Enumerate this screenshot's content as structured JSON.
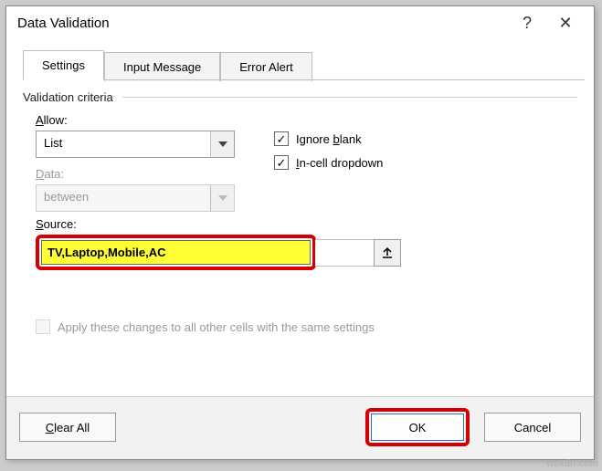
{
  "dialog": {
    "title": "Data Validation",
    "help_icon": "?",
    "close_icon": "✕"
  },
  "tabs": {
    "settings": "Settings",
    "input_message": "Input Message",
    "error_alert": "Error Alert"
  },
  "criteria": {
    "legend": "Validation criteria",
    "allow_label_pre": "A",
    "allow_label_post": "llow:",
    "allow_value": "List",
    "data_label_pre": "D",
    "data_label_post": "ata:",
    "data_value": "between",
    "ignore_blank_pre": "Ignore ",
    "ignore_blank_u": "b",
    "ignore_blank_post": "lank",
    "incell_pre": "I",
    "incell_post": "n-cell dropdown",
    "source_label_pre": "S",
    "source_label_post": "ource:",
    "source_value": "TV,Laptop,Mobile,AC",
    "apply_pre": "Apply these changes to all other cells with the same settings"
  },
  "footer": {
    "clear_pre": "C",
    "clear_post": "lear All",
    "ok": "OK",
    "cancel": "Cancel"
  },
  "watermark": "wsxdn.com"
}
